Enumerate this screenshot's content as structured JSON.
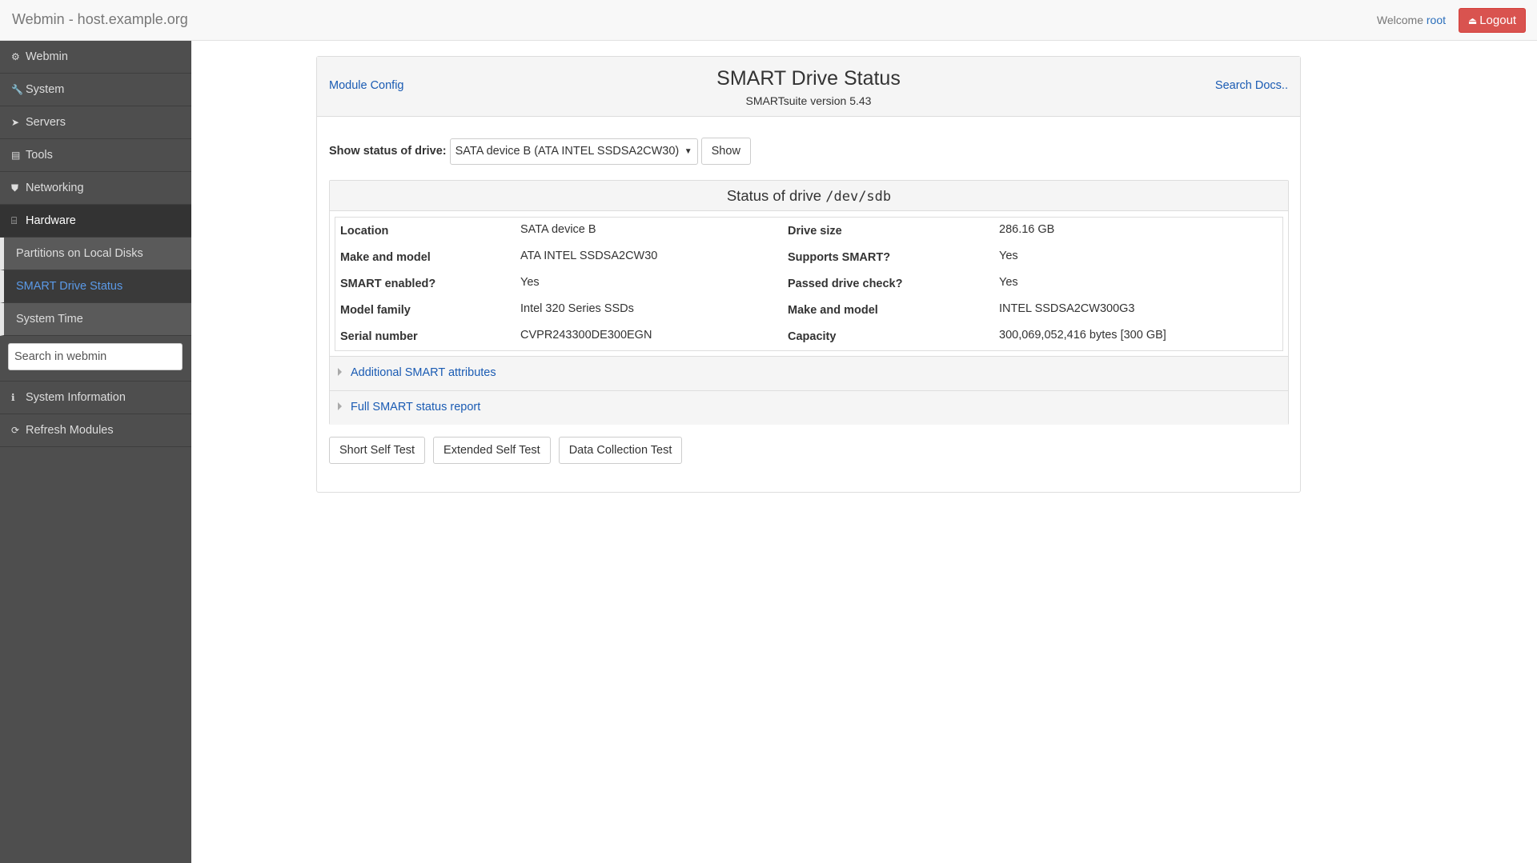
{
  "app": {
    "title": "Webmin - host.example.org",
    "welcome_text": "Welcome",
    "user": "root",
    "logout_label": "Logout"
  },
  "sidebar": {
    "items": [
      {
        "label": "Webmin",
        "icon": "gear-icon"
      },
      {
        "label": "System",
        "icon": "wrench-icon"
      },
      {
        "label": "Servers",
        "icon": "rocket-icon"
      },
      {
        "label": "Tools",
        "icon": "file-icon"
      },
      {
        "label": "Networking",
        "icon": "shield-icon"
      },
      {
        "label": "Hardware",
        "icon": "hdd-icon"
      }
    ],
    "subitems": [
      {
        "label": "Partitions on Local Disks"
      },
      {
        "label": "SMART Drive Status"
      },
      {
        "label": "System Time"
      }
    ],
    "search_placeholder": "Search in webmin",
    "bottom_items": [
      {
        "label": "System Information",
        "icon": "info-icon"
      },
      {
        "label": "Refresh Modules",
        "icon": "refresh-icon"
      }
    ]
  },
  "panel": {
    "module_config": "Module Config",
    "search_docs": "Search Docs..",
    "title": "SMART Drive Status",
    "subtitle": "SMARTsuite version 5.43",
    "drive_label": "Show status of drive:",
    "drive_selected": "SATA device B (ATA INTEL SSDSA2CW30)",
    "show_button": "Show",
    "status_title": "Status of drive",
    "status_device": "/dev/sdb",
    "rows": [
      {
        "k1": "Location",
        "v1": "SATA device B",
        "k2": "Drive size",
        "v2": "286.16 GB"
      },
      {
        "k1": "Make and model",
        "v1": "ATA INTEL SSDSA2CW30",
        "k2": "Supports SMART?",
        "v2": "Yes"
      },
      {
        "k1": "SMART enabled?",
        "v1": "Yes",
        "k2": "Passed drive check?",
        "v2": "Yes"
      },
      {
        "k1": "Model family",
        "v1": "Intel 320 Series SSDs",
        "k2": "Make and model",
        "v2": "INTEL SSDSA2CW300G3"
      },
      {
        "k1": "Serial number",
        "v1": "CVPR243300DE300EGN",
        "k2": "Capacity",
        "v2": "300,069,052,416 bytes [300 GB]"
      }
    ],
    "additional_attrs": "Additional SMART attributes",
    "full_report": "Full SMART status report",
    "tests": [
      "Short Self Test",
      "Extended Self Test",
      "Data Collection Test"
    ]
  }
}
